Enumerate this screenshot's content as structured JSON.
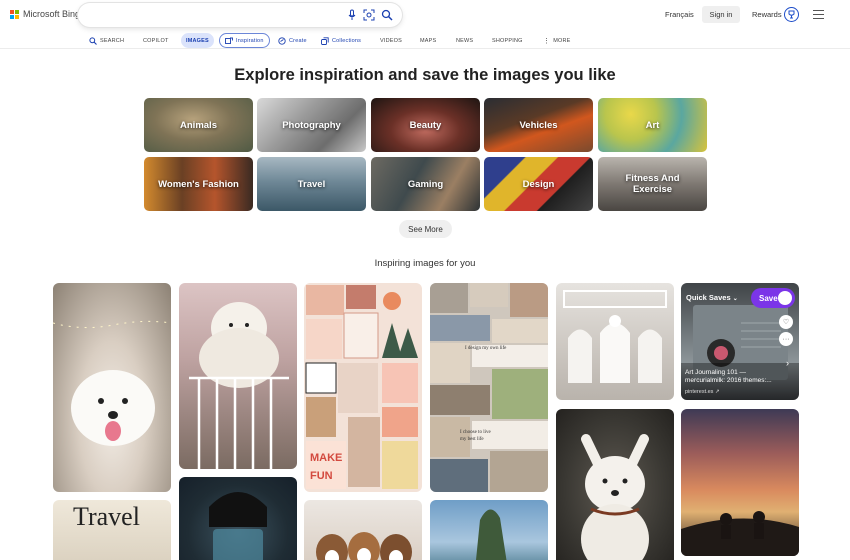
{
  "brand": {
    "name": "Microsoft Bing"
  },
  "search": {
    "value": "",
    "placeholder": ""
  },
  "header": {
    "language": "Français",
    "sign_in": "Sign in",
    "rewards": "Rewards"
  },
  "nav": {
    "search": "SEARCH",
    "copilot": "COPILOT",
    "images": "IMAGES",
    "inspiration": "Inspiration",
    "create": "Create",
    "collections": "Collections",
    "videos": "VIDEOS",
    "maps": "MAPS",
    "news": "NEWS",
    "shopping": "SHOPPING",
    "more": "MORE"
  },
  "main": {
    "title": "Explore inspiration and save the images you like",
    "categories": [
      "Animals",
      "Photography",
      "Beauty",
      "Vehicles",
      "Art",
      "Women's Fashion",
      "Travel",
      "Gaming",
      "Design",
      "Fitness And Exercise"
    ],
    "see_more": "See More",
    "subtitle": "Inspiring images for you"
  },
  "featured_card": {
    "quick_saves": "Quick Saves",
    "save": "Save",
    "caption": "Art Journaling 101 — mercurialmilk: 2016 themes:...",
    "source": "pinterest.es"
  },
  "travel_card_text": "Travel",
  "colors": {
    "accent": "#1a3fb0",
    "save_purple": "#7b35e8",
    "tab_active_bg": "#dbe3fb"
  }
}
